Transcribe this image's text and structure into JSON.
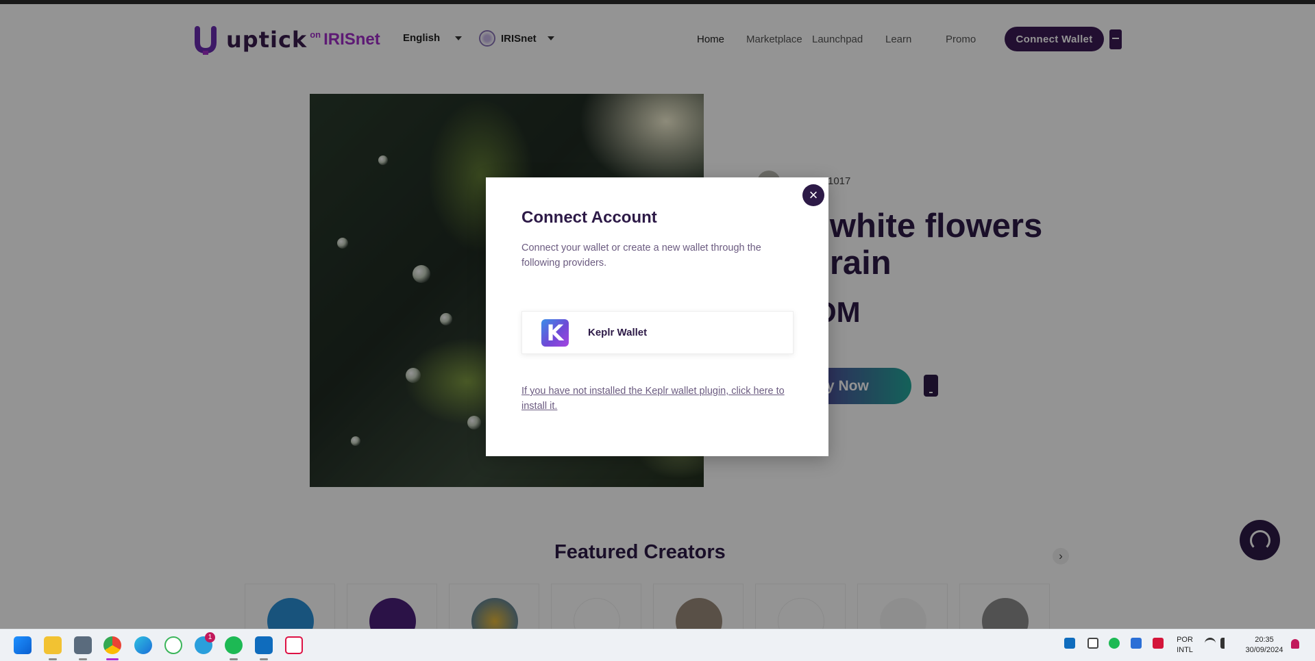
{
  "header": {
    "logo_word": "uptick",
    "logo_on": "on",
    "logo_network": "IRISnet",
    "language": "English",
    "network": "IRISnet",
    "nav": [
      "Home",
      "Marketplace",
      "Launchpad",
      "Learn",
      "Promo"
    ],
    "connect_button": "Connect Wallet"
  },
  "hero": {
    "creator_id": "1017",
    "title_line1": "e white flowers",
    "title_line2": "e rain",
    "price": "OM",
    "buy_button": "y Now"
  },
  "featured": {
    "title": "Featured Creators"
  },
  "modal": {
    "title": "Connect Account",
    "description": "Connect your wallet or create a new wallet through the following providers.",
    "wallet_name": "Keplr Wallet",
    "wallet_logo_letter": "K",
    "install_link": "If you have not installed the Keplr wallet plugin, click here to install it.",
    "close_symbol": "×"
  },
  "taskbar": {
    "telegram_badge": "1",
    "lang_line1": "POR",
    "lang_line2": "INTL",
    "time": "20:35",
    "date": "30/09/2024"
  },
  "colors": {
    "brand_dark": "#2d1a47",
    "brand_purple": "#a12ec9",
    "overlay": "rgba(0,0,0,0.42)"
  }
}
